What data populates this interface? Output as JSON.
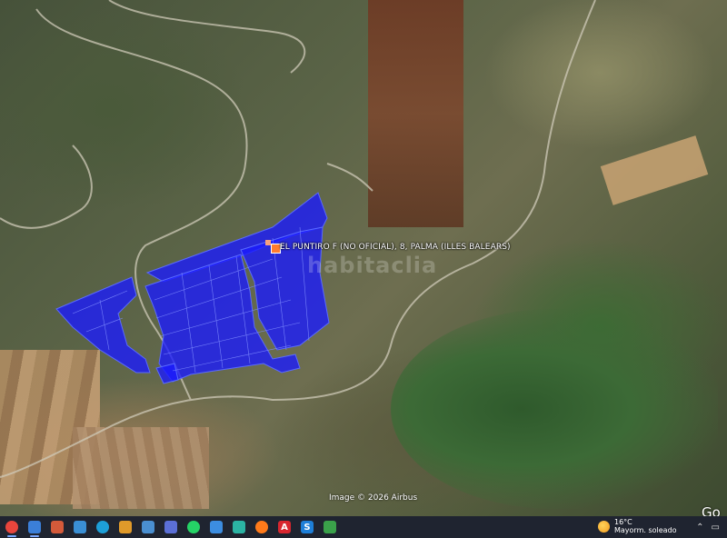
{
  "map": {
    "place_label": "EL PUNTIRO F (NO OFICIAL), 8, PALMA (ILLES BALEARS)",
    "watermark": "habitaclia",
    "imagery_credit": "Image © 2026 Airbus",
    "brand_partial": "Go",
    "overlay_color": "#1a1aff",
    "pin_color": "#ff7b2e"
  },
  "taskbar": {
    "icons": [
      {
        "name": "chrome-icon",
        "glyph": "",
        "color": "#e8453c"
      },
      {
        "name": "app-icon-1",
        "glyph": "",
        "color": "#3b7fd9"
      },
      {
        "name": "app-icon-2",
        "glyph": "",
        "color": "#d45a3a"
      },
      {
        "name": "app-icon-3",
        "glyph": "",
        "color": "#3a8fd4"
      },
      {
        "name": "edge-icon",
        "glyph": "",
        "color": "#1d9fd8"
      },
      {
        "name": "app-icon-4",
        "glyph": "",
        "color": "#e09a2a"
      },
      {
        "name": "app-icon-5",
        "glyph": "",
        "color": "#4a8fd0"
      },
      {
        "name": "app-icon-6",
        "glyph": "",
        "color": "#5b6fd6"
      },
      {
        "name": "whatsapp-icon",
        "glyph": "",
        "color": "#25d366"
      },
      {
        "name": "app-icon-7",
        "glyph": "",
        "color": "#3c8de0"
      },
      {
        "name": "app-icon-8",
        "glyph": "",
        "color": "#2bb3a3"
      },
      {
        "name": "firefox-icon",
        "glyph": "",
        "color": "#ff7a1a"
      },
      {
        "name": "app-icon-a",
        "glyph": "A",
        "color": "#d8262f"
      },
      {
        "name": "app-icon-s",
        "glyph": "S",
        "color": "#1e7fd8"
      },
      {
        "name": "app-icon-9",
        "glyph": "",
        "color": "#3aa14a"
      }
    ],
    "weather": {
      "temp": "16°C",
      "condition": "Mayorm. soleado"
    }
  }
}
